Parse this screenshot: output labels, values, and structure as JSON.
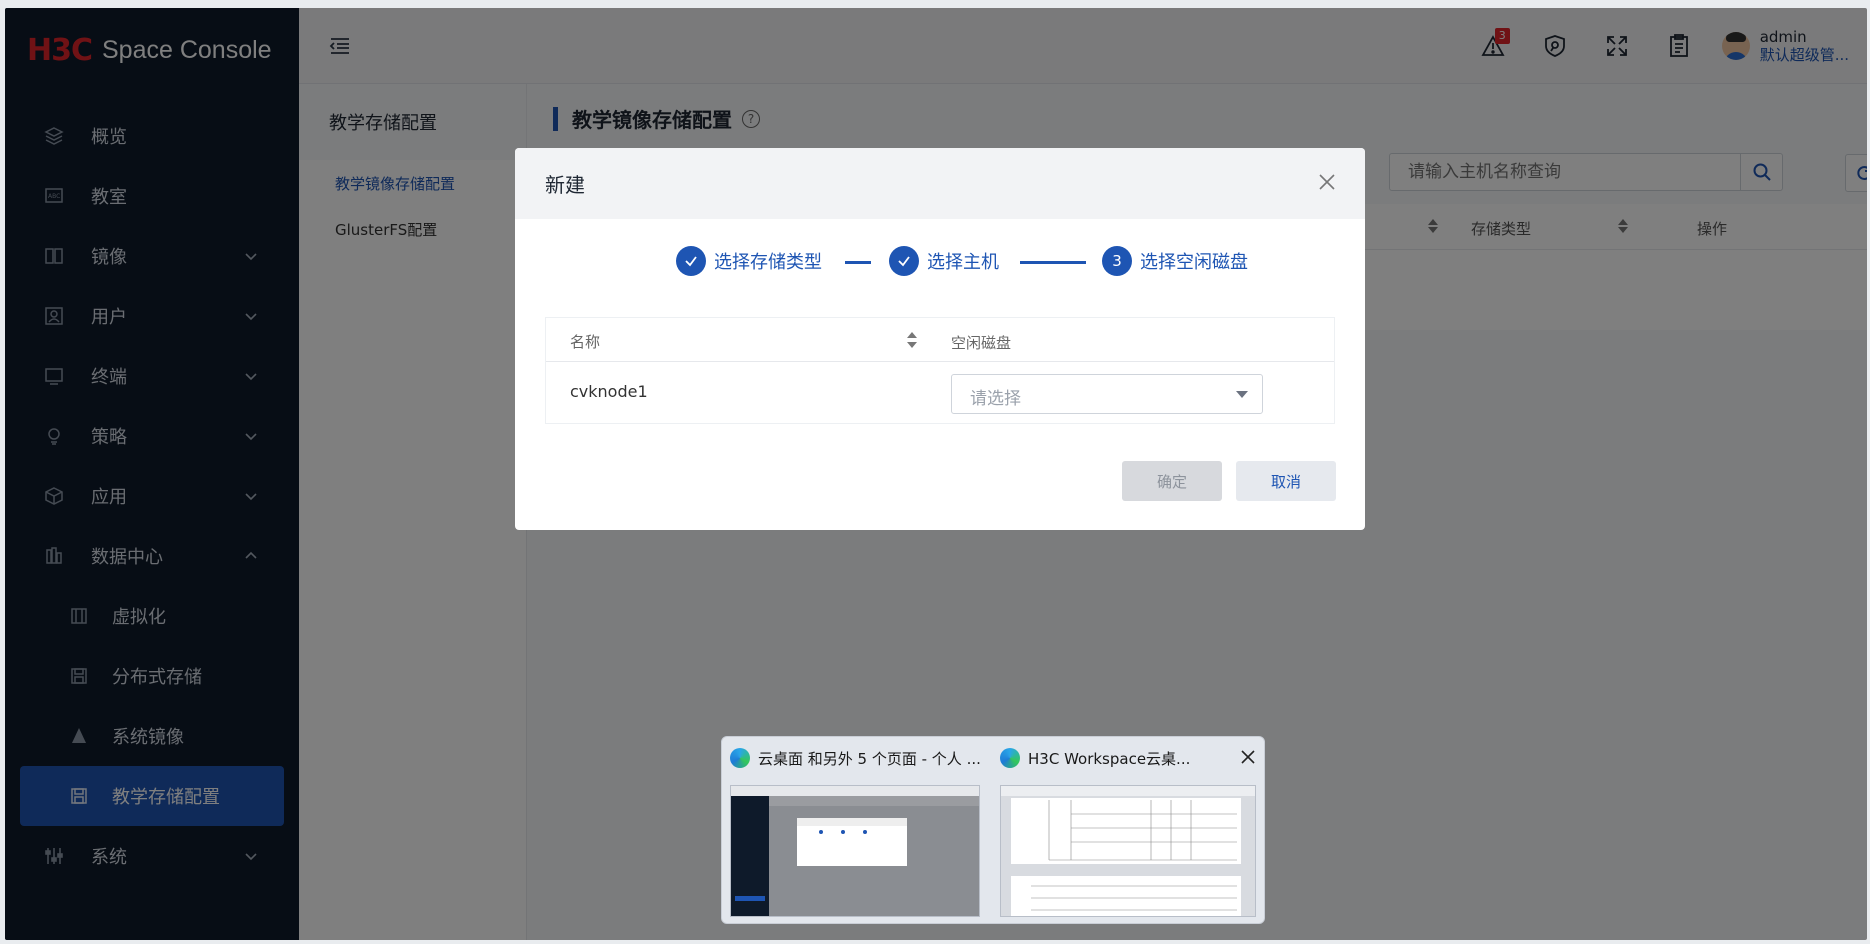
{
  "app": {
    "logo": "H3C",
    "title": "Space Console"
  },
  "sidebar": {
    "items": [
      {
        "label": "概览",
        "icon": "layers-icon",
        "expandable": false
      },
      {
        "label": "教室",
        "icon": "classroom-icon",
        "expandable": false
      },
      {
        "label": "镜像",
        "icon": "image-icon",
        "expandable": true
      },
      {
        "label": "用户",
        "icon": "user-icon",
        "expandable": true
      },
      {
        "label": "终端",
        "icon": "terminal-icon",
        "expandable": true
      },
      {
        "label": "策略",
        "icon": "policy-icon",
        "expandable": true
      },
      {
        "label": "应用",
        "icon": "app-box-icon",
        "expandable": true
      },
      {
        "label": "数据中心",
        "icon": "datacenter-icon",
        "expandable": true,
        "expanded": true
      }
    ],
    "sub_items": [
      {
        "label": "虚拟化",
        "icon": "virtualization-icon"
      },
      {
        "label": "分布式存储",
        "icon": "storage-icon"
      },
      {
        "label": "系统镜像",
        "icon": "system-image-icon"
      },
      {
        "label": "教学存储配置",
        "icon": "storage-config-icon",
        "active": true
      }
    ],
    "bottom_item": {
      "label": "系统",
      "icon": "settings-sliders-icon"
    }
  },
  "topbar": {
    "alert_count": "3",
    "user_name": "admin",
    "user_role": "默认超级管..."
  },
  "subnav": {
    "title": "教学存储配置",
    "items": [
      "教学镜像存储配置",
      "GlusterFS配置"
    ]
  },
  "main": {
    "title": "教学镜像存储配置",
    "search_placeholder": "请输入主机名称查询",
    "columns": [
      "存储类型",
      "操作"
    ]
  },
  "dialog": {
    "title": "新建",
    "steps": [
      "选择存储类型",
      "选择主机",
      "选择空闲磁盘"
    ],
    "current_step_number": "3",
    "table": {
      "headers": [
        "名称",
        "空闲磁盘"
      ],
      "rows": [
        {
          "name": "cvknode1",
          "disk_placeholder": "请选择"
        }
      ]
    },
    "ok_label": "确定",
    "cancel_label": "取消"
  },
  "taskbar_preview": {
    "windows": [
      "云桌面 和另外 5 个页面 - 个人 ...",
      "H3C Workspace云桌..."
    ]
  },
  "colors": {
    "accent": "#1e55b3",
    "sidebar_bg": "#0e1a2a",
    "brand_red": "#e0242b"
  }
}
